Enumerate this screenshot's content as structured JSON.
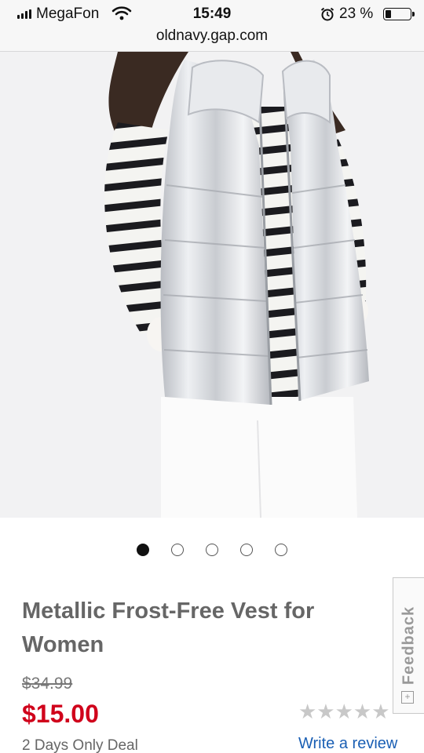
{
  "status_bar": {
    "carrier": "MegaFon",
    "time": "15:49",
    "battery_percent": "23 %",
    "battery_level": 0.23
  },
  "browser": {
    "url": "oldnavy.gap.com"
  },
  "carousel": {
    "total": 5,
    "active_index": 0
  },
  "product": {
    "title": "Metallic Frost-Free Vest for Women",
    "original_price": "$34.99",
    "sale_price": "$15.00",
    "deal_label": "2 Days Only Deal",
    "rating_stars": "★★★★★",
    "write_review_label": "Write a review"
  },
  "feedback_tab": {
    "label": "Feedback",
    "icon_text": "+"
  },
  "colors": {
    "sale_price": "#d0021b",
    "link": "#1a5fb4",
    "title_text": "#666666"
  }
}
